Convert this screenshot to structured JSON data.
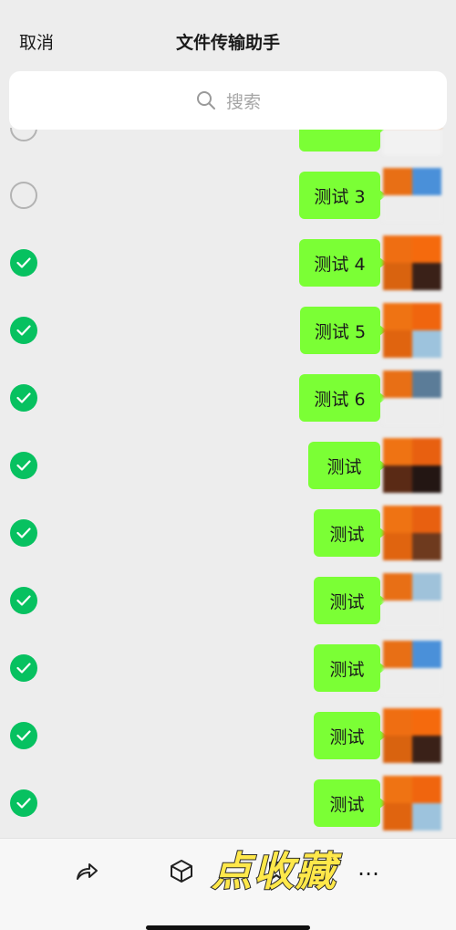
{
  "header": {
    "cancel_label": "取消",
    "title": "文件传输助手"
  },
  "search": {
    "placeholder": "搜索",
    "icon": "search-icon"
  },
  "messages": [
    {
      "text": "",
      "selected": false,
      "partial": true
    },
    {
      "text": "测试 3",
      "selected": false
    },
    {
      "text": "测试 4",
      "selected": true
    },
    {
      "text": "测试 5",
      "selected": true
    },
    {
      "text": "测试 6",
      "selected": true
    },
    {
      "text": "测试",
      "selected": true
    },
    {
      "text": "测试",
      "selected": true
    },
    {
      "text": "测试",
      "selected": true
    },
    {
      "text": "测试",
      "selected": true
    },
    {
      "text": "测试",
      "selected": true
    },
    {
      "text": "测试",
      "selected": true
    }
  ],
  "toolbar": {
    "actions": [
      "forward-icon",
      "box-icon",
      "favorite-icon",
      "more-icon"
    ],
    "more_label": "…",
    "overlay_caption": "点收藏"
  },
  "colors": {
    "bubble": "#7bff35",
    "check": "#07c160",
    "accent": "#ffe84a"
  }
}
